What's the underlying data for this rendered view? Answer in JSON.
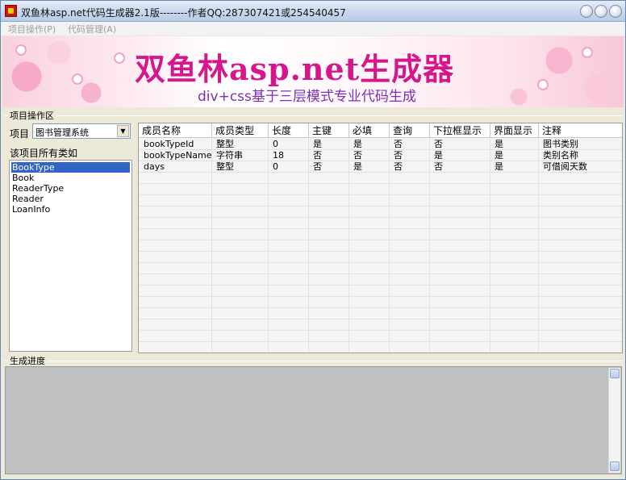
{
  "window": {
    "title": "双鱼林asp.net代码生成器2.1版--------作者QQ:287307421或254540457"
  },
  "menu": [
    {
      "label": "项目操作(P)"
    },
    {
      "label": "代码管理(A)"
    }
  ],
  "banner": {
    "title": "双鱼林asp.net生成器",
    "subtitle": "div+css基于三层模式专业代码生成"
  },
  "project_area": {
    "group_label": "项目操作区",
    "project_label": "项目",
    "project_value": "图书管理系统",
    "classes_label": "该项目所有类如",
    "classes": [
      "BookType",
      "Book",
      "ReaderType",
      "Reader",
      "LoanInfo"
    ],
    "selected_class": "BookType"
  },
  "grid": {
    "columns": [
      "成员名称",
      "成员类型",
      "长度",
      "主键",
      "必填",
      "查询",
      "下拉框显示",
      "界面显示",
      "注释"
    ],
    "rows": [
      [
        "bookTypeId",
        "整型",
        "0",
        "是",
        "是",
        "否",
        "否",
        "是",
        "图书类别"
      ],
      [
        "bookTypeName",
        "字符串",
        "18",
        "否",
        "否",
        "否",
        "是",
        "是",
        "类别名称"
      ],
      [
        "days",
        "整型",
        "0",
        "否",
        "是",
        "否",
        "否",
        "是",
        "可借阅天数"
      ]
    ]
  },
  "progress": {
    "group_label": "生成进度",
    "content": ""
  },
  "colors": {
    "banner_title": "#d6178c",
    "banner_subtitle": "#7b2fb5",
    "selection": "#3164c5"
  }
}
